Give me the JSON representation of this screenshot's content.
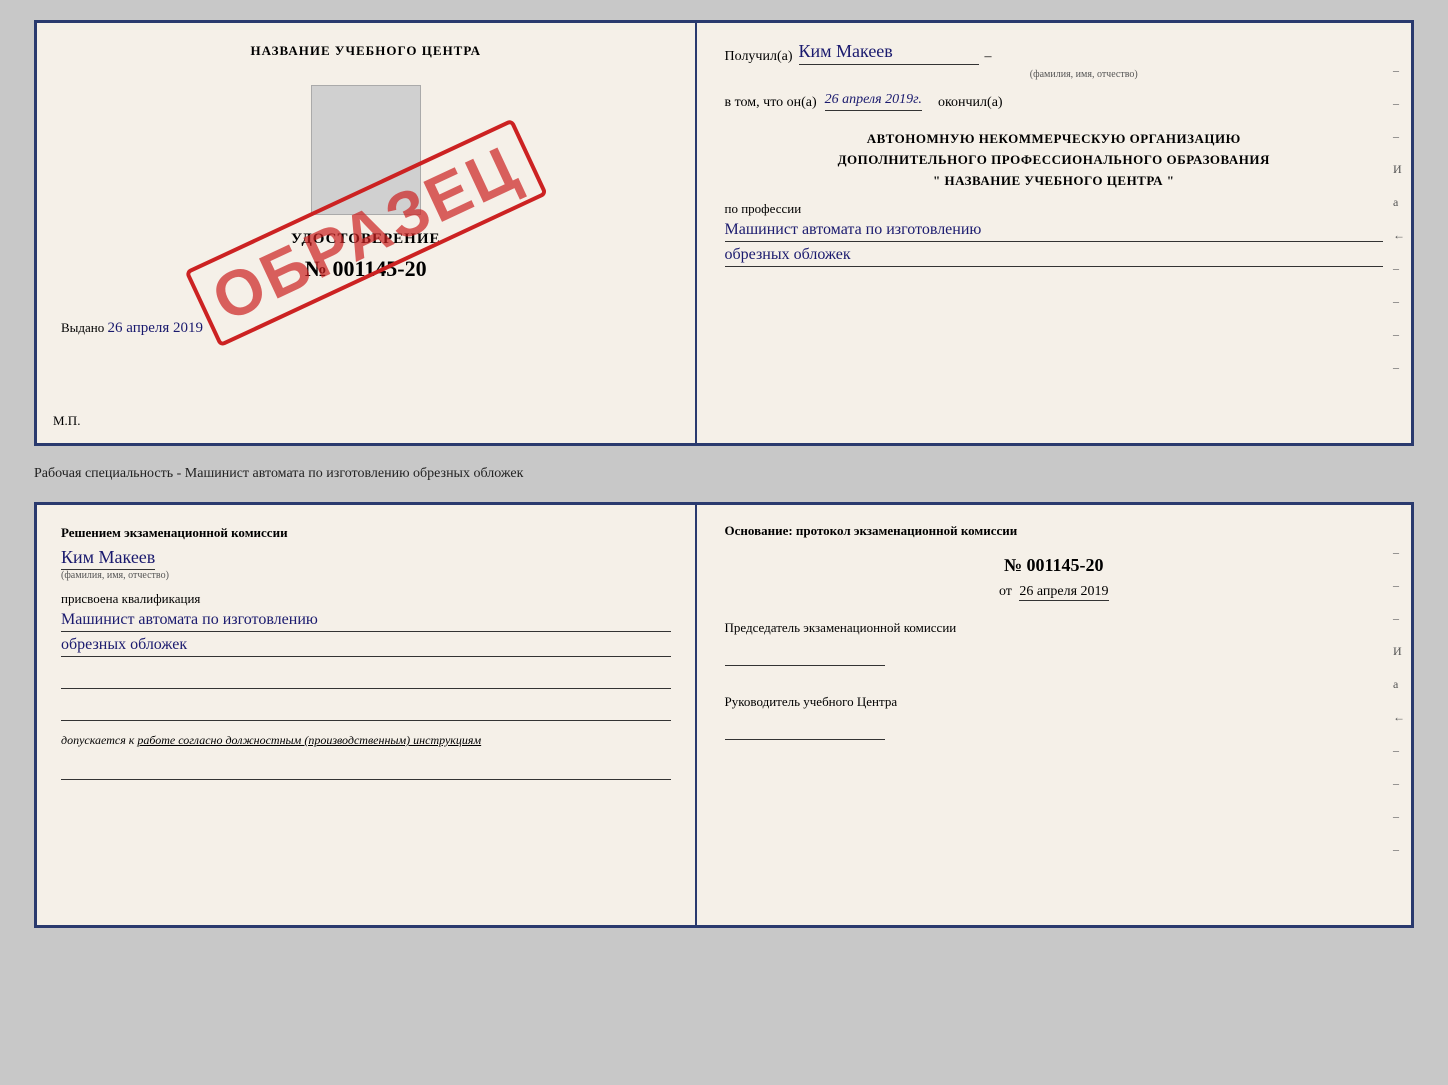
{
  "top_doc": {
    "left": {
      "school_title": "НАЗВАНИЕ УЧЕБНОГО ЦЕНТРА",
      "cert_label": "УДОСТОВЕРЕНИЕ",
      "cert_number": "№ 001145-20",
      "issued_text": "Выдано",
      "issued_date": "26 апреля 2019",
      "mp_label": "М.П.",
      "stamp": "ОБРАЗЕЦ"
    },
    "right": {
      "received_prefix": "Получил(а)",
      "recipient_name": "Ким Макеев",
      "fio_label": "(фамилия, имя, отчество)",
      "in_that_prefix": "в том, что он(а)",
      "completion_date": "26 апреля 2019г.",
      "finished_suffix": "окончил(а)",
      "org_line1": "АВТОНОМНУЮ НЕКОММЕРЧЕСКУЮ ОРГАНИЗАЦИЮ",
      "org_line2": "ДОПОЛНИТЕЛЬНОГО ПРОФЕССИОНАЛЬНОГО ОБРАЗОВАНИЯ",
      "org_line3": "\"   НАЗВАНИЕ УЧЕБНОГО ЦЕНТРА   \"",
      "profession_label": "по профессии",
      "profession_handwritten_1": "Машинист автомата по изготовлению",
      "profession_handwritten_2": "обрезных обложек",
      "side_marks": [
        "–",
        "–",
        "–",
        "И",
        "а",
        "←",
        "–",
        "–",
        "–",
        "–",
        "–"
      ]
    }
  },
  "between_caption": "Рабочая специальность - Машинист автомата по изготовлению обрезных обложек",
  "bottom_doc": {
    "left": {
      "decision_text": "Решением экзаменационной комиссии",
      "person_name": "Ким Макеев",
      "fio_label": "(фамилия, имя, отчество)",
      "qual_assigned_label": "присвоена квалификация",
      "qual_line1": "Машинист автомата по изготовлению",
      "qual_line2": "обрезных обложек",
      "admitted_prefix": "допускается к",
      "admitted_text": "работе согласно должностным (производственным) инструкциям"
    },
    "right": {
      "basis_label": "Основание: протокол экзаменационной комиссии",
      "protocol_number": "№  001145-20",
      "date_prefix": "от",
      "protocol_date": "26 апреля 2019",
      "chairman_label": "Председатель экзаменационной комиссии",
      "center_head_label": "Руководитель учебного Центра",
      "side_marks": [
        "–",
        "–",
        "–",
        "И",
        "а",
        "←",
        "–",
        "–",
        "–",
        "–",
        "–"
      ]
    }
  }
}
